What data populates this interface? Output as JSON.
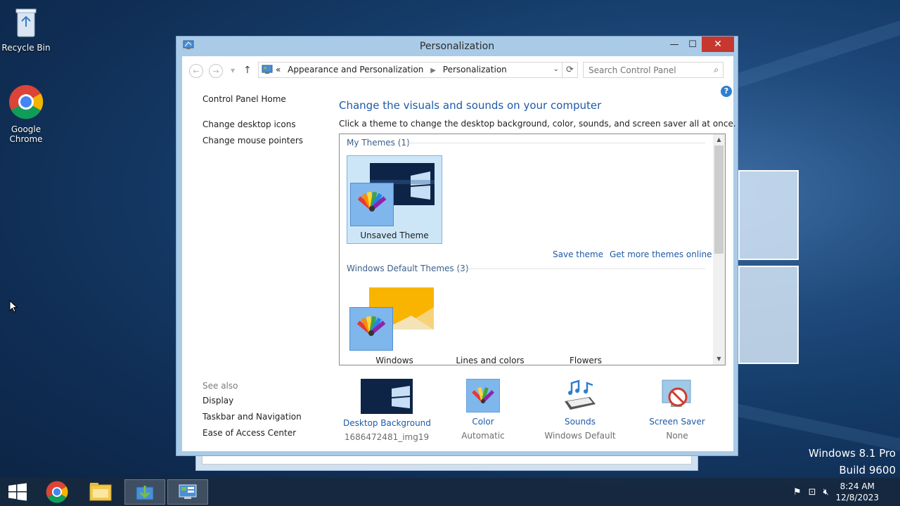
{
  "desktop": {
    "icons": [
      {
        "label": "Recycle Bin",
        "icon": "recycle-bin-icon"
      },
      {
        "label": "Google Chrome",
        "icon": "chrome-icon"
      }
    ],
    "watermark_line1": "Windows 8.1 Pro",
    "watermark_line2": "Build 9600"
  },
  "window": {
    "title": "Personalization",
    "minimize": "—",
    "maximize": "☐",
    "close": "✕"
  },
  "address": {
    "chevron": "«",
    "crumbs": [
      "Appearance and Personalization",
      "Personalization"
    ],
    "search_placeholder": "Search Control Panel"
  },
  "left_pane": {
    "links": [
      "Control Panel Home",
      "Change desktop icons",
      "Change mouse pointers"
    ],
    "see_also": "See also",
    "see_also_links": [
      "Display",
      "Taskbar and Navigation",
      "Ease of Access Center"
    ]
  },
  "content": {
    "heading": "Change the visuals and sounds on your computer",
    "subheading": "Click a theme to change the desktop background, color, sounds, and screen saver all at once.",
    "my_themes_label": "My Themes (1)",
    "my_themes": [
      {
        "name": "Unsaved Theme",
        "selected": true
      }
    ],
    "save_theme": "Save theme",
    "get_more": "Get more themes online",
    "default_label": "Windows Default Themes (3)",
    "default_themes": [
      "Windows",
      "Lines and colors",
      "Flowers"
    ]
  },
  "bottom": [
    {
      "label": "Desktop Background",
      "value": "1686472481_img19",
      "icon": "desktop-background-icon"
    },
    {
      "label": "Color",
      "value": "Automatic",
      "icon": "color-icon"
    },
    {
      "label": "Sounds",
      "value": "Windows Default",
      "icon": "sounds-icon"
    },
    {
      "label": "Screen Saver",
      "value": "None",
      "icon": "screen-saver-icon"
    }
  ],
  "taskbar": {
    "time": "8:24 AM",
    "date": "12/8/2023"
  }
}
